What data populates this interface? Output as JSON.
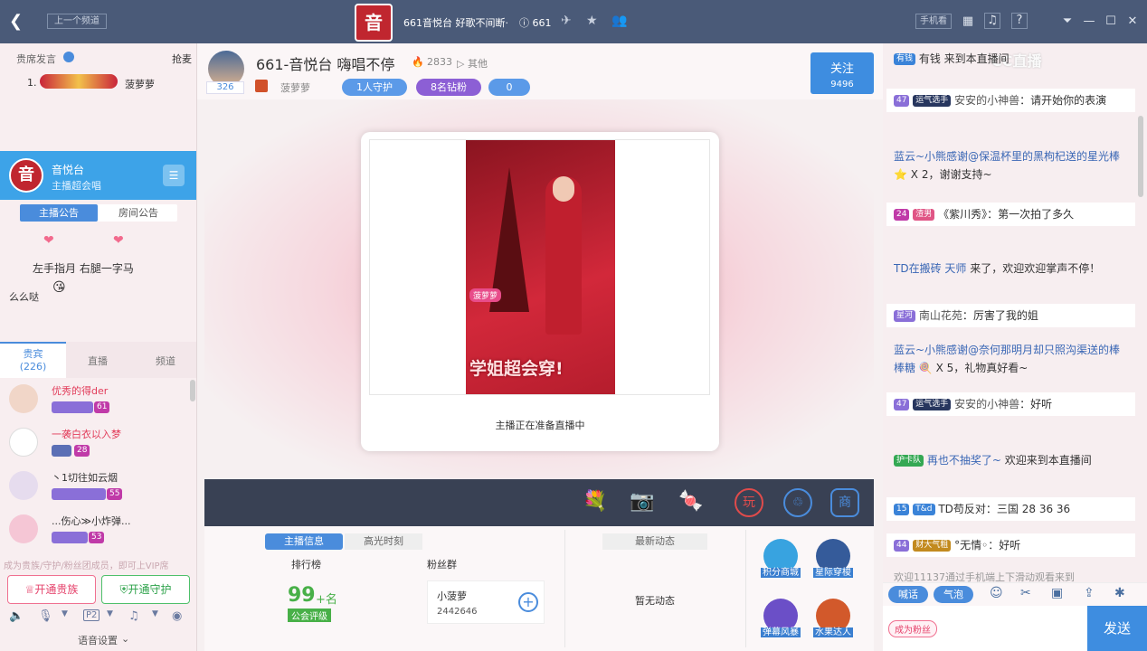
{
  "topbar": {
    "prev_channel": "上一个频道",
    "room_title": "661音悦台 好歌不间断·",
    "room_id": "661",
    "logo_char": "音",
    "phone_label": "手机看"
  },
  "anchor": {
    "name": "661-音悦台 嗨唱不停",
    "heat": "2833",
    "other": "其他",
    "fans_count": "326",
    "host": "菠萝萝",
    "guard": "1人守护",
    "diamond": "8名钻粉",
    "follow_label": "关注",
    "follow_count": "9496",
    "viewers": "0"
  },
  "left": {
    "rank_title": "贵席发言",
    "grab": "抢麦",
    "rank_item": "1.",
    "rank_host": "菠萝萝",
    "channel_name": "音悦台",
    "channel_sub": "主播超会唱",
    "logo_char": "音",
    "tabs": [
      "主播公告",
      "房间公告"
    ],
    "notice_lines": [
      "左手指月 右腿一字马",
      "么么哒"
    ],
    "list_tabs": [
      "贵宾",
      "直播",
      "频道"
    ],
    "guest_count": "(226)",
    "users": [
      {
        "name": "优秀的得der",
        "color": "#e23c5a",
        "level": "61"
      },
      {
        "name": "一袭白衣以入梦",
        "color": "#e23c5a",
        "level": "28"
      },
      {
        "name": "丶1切往如云烟",
        "color": "#333333",
        "level": "55"
      },
      {
        "name": "...伤心≫小炸弹...",
        "color": "#333333",
        "level": "53"
      }
    ],
    "vip_tip": "成为贵族/守护/粉丝团成员，即可上VIP席",
    "btn_noble": "开通贵族",
    "btn_guard": "开通守护",
    "voice_settings": "语音设置"
  },
  "stage": {
    "poster_text": "学姐超会穿!",
    "poster_tag": "菠萝萝",
    "status": "主播正在准备直播中"
  },
  "info": {
    "tabs": [
      "主播信息",
      "高光时刻"
    ],
    "rank_label": "排行榜",
    "fans_label": "粉丝群",
    "rank_value": "99",
    "rank_suffix": "+名",
    "rank_sub": "公会评级",
    "fan_name": "小菠萝",
    "fan_id": "2442646",
    "news_tab": "最新动态",
    "news_empty": "暂无动态",
    "shop": [
      "积分商城",
      "星际穿梭",
      "弹幕风暴",
      "水果达人"
    ]
  },
  "chat": {
    "watermark": "CC直播",
    "m1": "有钱 来到本直播间",
    "m2_name": "安安的小神兽",
    "m2_text": "：请开始你的表演",
    "m3": "蓝云~小熊感谢@保温杯里的黑枸杞送的星光棒",
    "m3_mult": "X 2，谢谢支持~",
    "m4_tag": "渣男",
    "m4_text": "《紫川秀》：第一次拍了多久",
    "m5_name": "TD在搬砖",
    "m5_user": "天师",
    "m5_text": "来了，欢迎欢迎掌声不停！",
    "m6_name": "南山花苑",
    "m6_text": "：厉害了我的姐",
    "m7": "蓝云~小熊感谢@奈何那明月却只照沟渠送的棒棒糖",
    "m7_mult": "X 5，礼物真好看~",
    "m8_name": "安安的小神兽",
    "m8_text": "：好听",
    "m9_name": "再也不抽奖了~",
    "m9_text": "欢迎来到本直播间",
    "m10_tag": "T&d",
    "m10_text": "TD苟反对",
    "m10_tail": "：三国 28 36 36",
    "m11_name": "°无情◦",
    "m11_text": "：好听",
    "m12": "欢迎11137通过手机端上下滑动观看来到",
    "quick1": "喊话",
    "quick2": "气泡",
    "fan_btn": "成为粉丝",
    "send": "发送"
  }
}
